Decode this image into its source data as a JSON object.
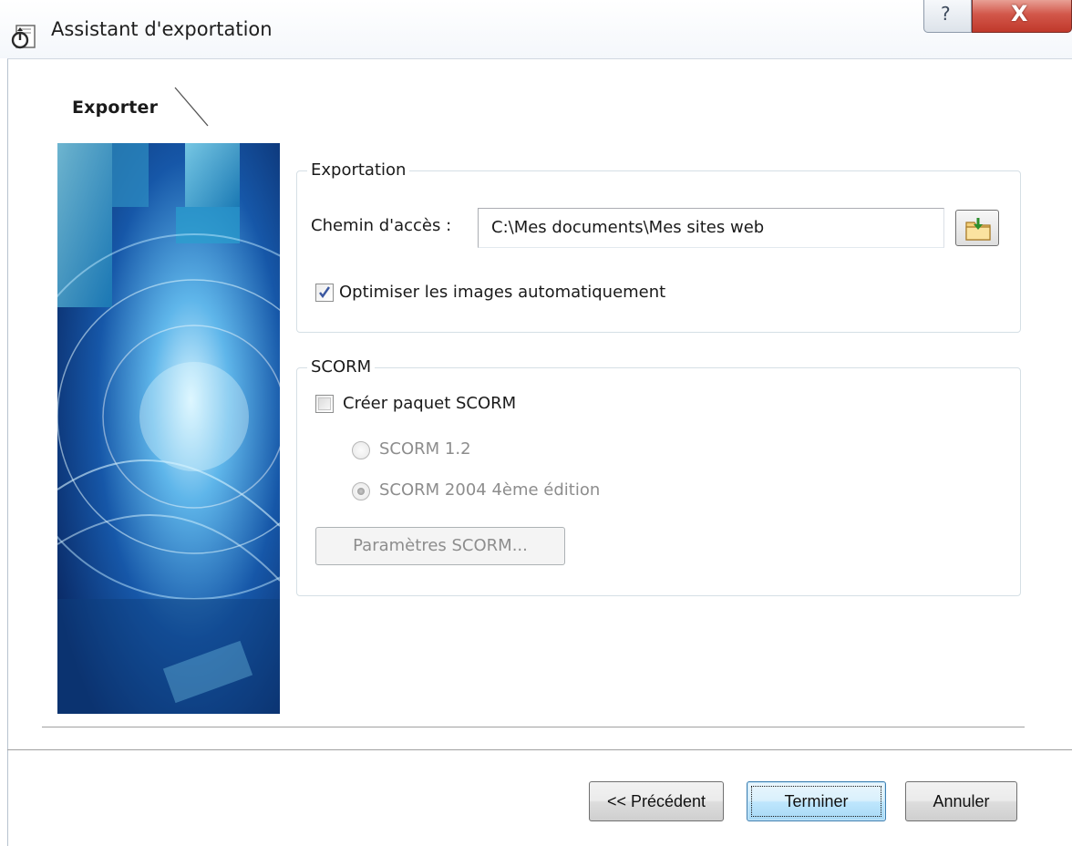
{
  "window": {
    "title": "Assistant d'exportation",
    "help_glyph": "?",
    "close_glyph": "X"
  },
  "step": {
    "label": "Exporter"
  },
  "export_group": {
    "title": "Exportation",
    "path_label": "Chemin d'accès :",
    "path_value": "C:\\Mes documents\\Mes sites web",
    "optimize_label": "Optimiser les images automatiquement",
    "optimize_checked": true
  },
  "scorm_group": {
    "title": "SCORM",
    "create_label": "Créer paquet SCORM",
    "create_checked": false,
    "options": [
      {
        "label": "SCORM 1.2",
        "selected": false
      },
      {
        "label": "SCORM 2004 4ème édition",
        "selected": true
      }
    ],
    "params_button": "Paramètres SCORM..."
  },
  "footer": {
    "previous": "<< Précédent",
    "finish": "Terminer",
    "cancel": "Annuler"
  },
  "icons": {
    "app": "export-wizard-icon",
    "browse": "folder-open-icon",
    "help": "help-icon",
    "close": "close-icon"
  },
  "colors": {
    "close_button": "#c0392b",
    "default_button_border": "#3c7fb1",
    "group_border": "#d5dfe5",
    "disabled_text": "#8d8d8d"
  }
}
